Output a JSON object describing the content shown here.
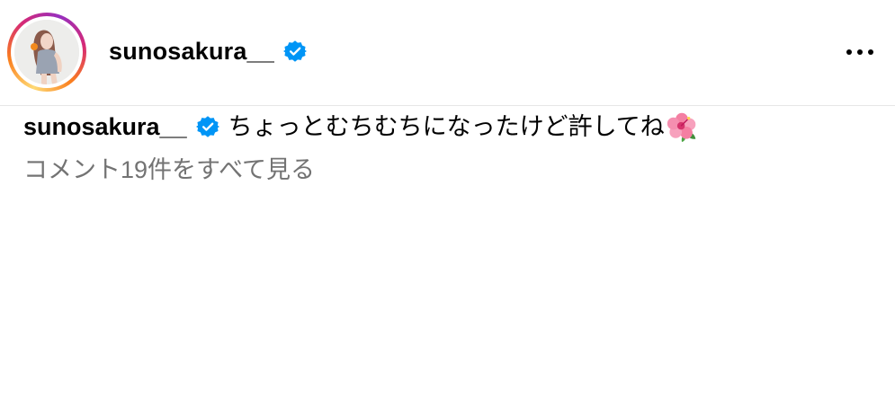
{
  "header": {
    "username": "sunosakura__",
    "avatar": "profile-photo",
    "verified_icon": "verified-badge-icon",
    "more_icon": "more-horizontal-icon"
  },
  "caption": {
    "username": "sunosakura__",
    "text": "ちょっとむちむちになったけど許してね",
    "emoji": "hibiscus-emoji"
  },
  "comments": {
    "view_all_label": "コメント19件をすべて見る"
  },
  "colors": {
    "verified_blue": "#0095f6",
    "muted_text": "#737373",
    "ring_gradient": [
      "#feda75",
      "#fa7e1e",
      "#d62976",
      "#962fbf"
    ]
  }
}
